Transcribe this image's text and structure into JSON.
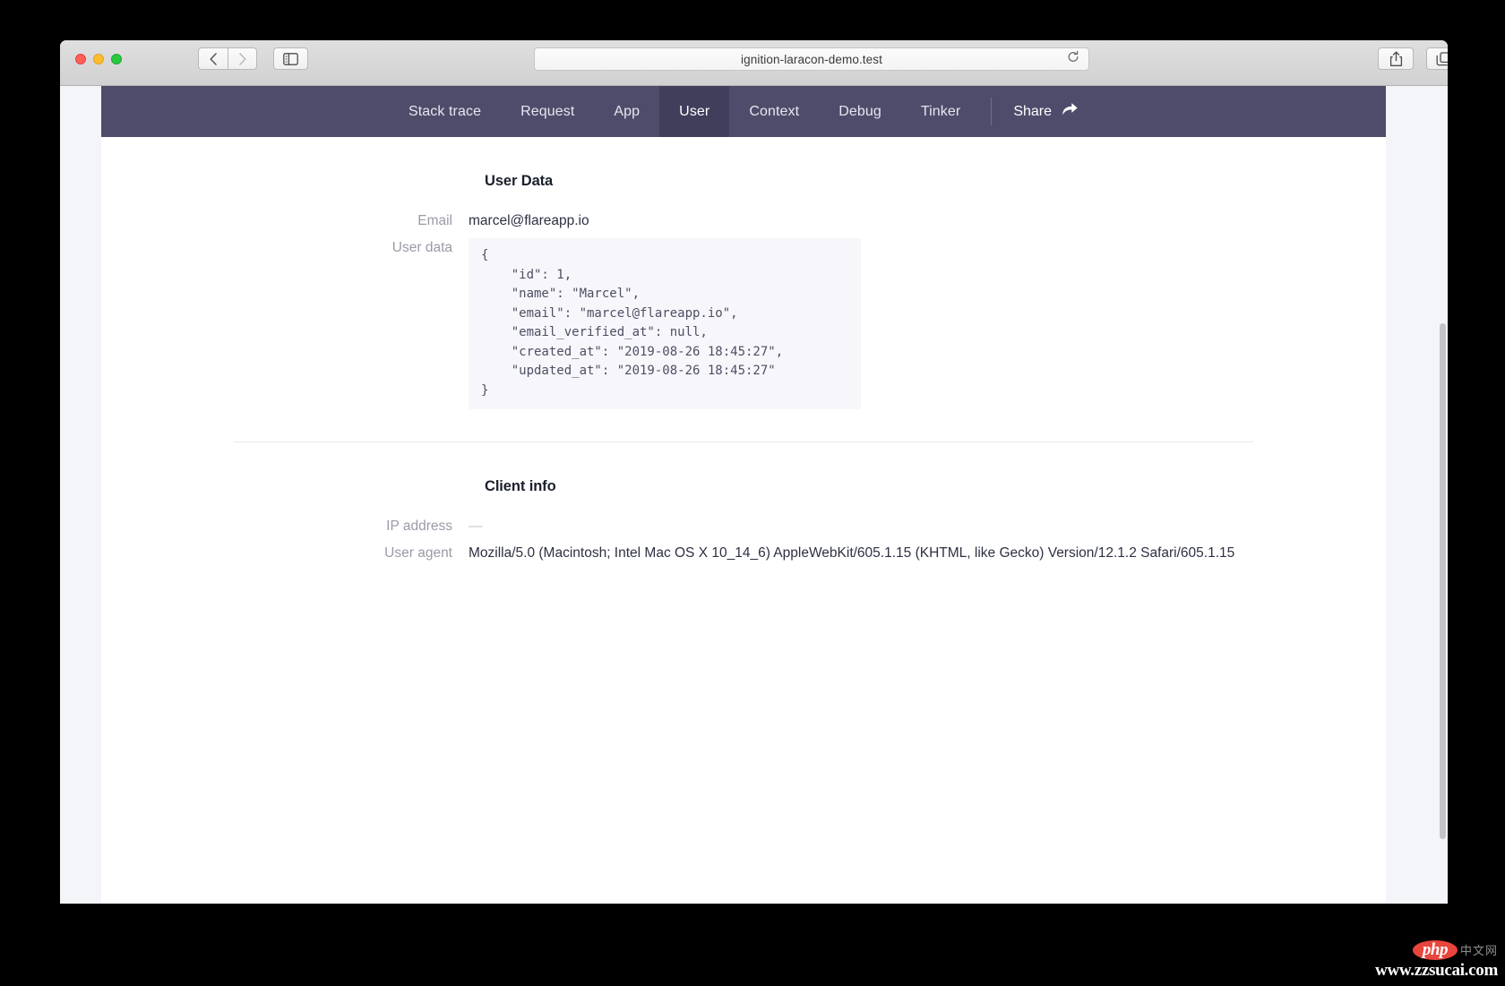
{
  "browser": {
    "url": "ignition-laracon-demo.test",
    "traffic_lights": [
      "close",
      "minimize",
      "maximize"
    ],
    "back_label": "‹",
    "forward_label": "›",
    "new_tab_label": "+"
  },
  "ignition_nav": {
    "tabs": [
      {
        "label": "Stack trace",
        "active": false
      },
      {
        "label": "Request",
        "active": false
      },
      {
        "label": "App",
        "active": false
      },
      {
        "label": "User",
        "active": true
      },
      {
        "label": "Context",
        "active": false
      },
      {
        "label": "Debug",
        "active": false
      },
      {
        "label": "Tinker",
        "active": false
      }
    ],
    "share_label": "Share"
  },
  "user_data_section": {
    "title": "User Data",
    "email_label": "Email",
    "email_value": "marcel@flareapp.io",
    "user_data_label": "User data",
    "user_data_json": "{\n    \"id\": 1,\n    \"name\": \"Marcel\",\n    \"email\": \"marcel@flareapp.io\",\n    \"email_verified_at\": null,\n    \"created_at\": \"2019-08-26 18:45:27\",\n    \"updated_at\": \"2019-08-26 18:45:27\"\n}"
  },
  "client_info_section": {
    "title": "Client info",
    "ip_label": "IP address",
    "ip_value": "—",
    "user_agent_label": "User agent",
    "user_agent_value": "Mozilla/5.0 (Macintosh; Intel Mac OS X 10_14_6) AppleWebKit/605.1.15 (KHTML, like Gecko) Version/12.1.2 Safari/605.1.15"
  },
  "watermark": {
    "logo": "php",
    "logo_suffix": "中文网",
    "url": "www.zzsucai.com"
  },
  "colors": {
    "nav_background": "#4f4c6b",
    "nav_active": "#413e5c",
    "page_background": "#f4f5f9",
    "code_background": "#f7f7fb",
    "label_text": "#9a9aa8",
    "body_text": "#2d3142"
  }
}
